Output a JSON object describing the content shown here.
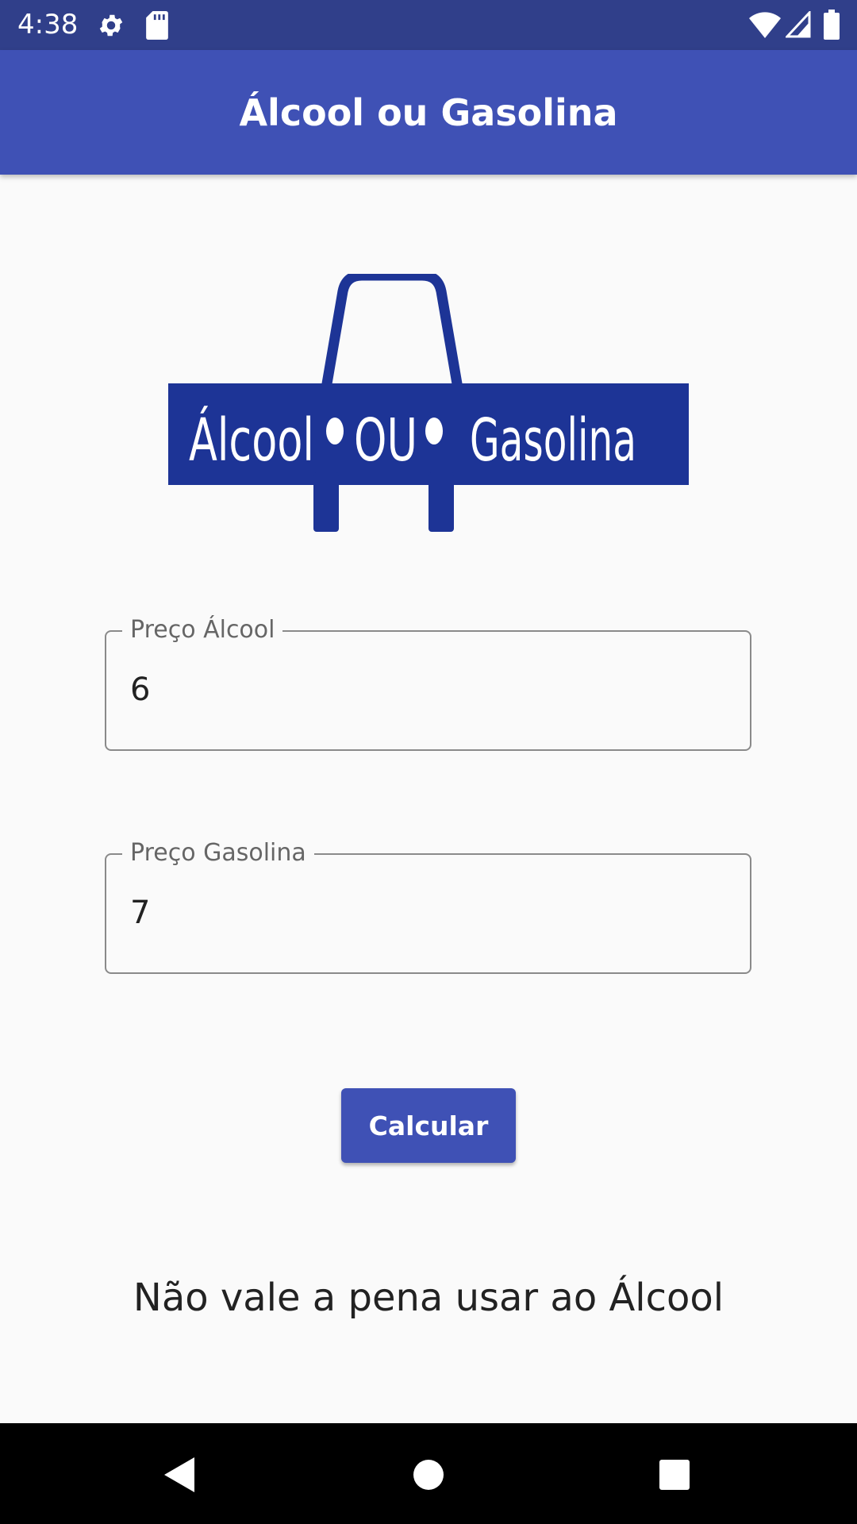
{
  "status_bar": {
    "time": "4:38",
    "icons": [
      "gear-icon",
      "sd-card-icon",
      "wifi-icon",
      "signal-icon",
      "battery-icon"
    ]
  },
  "app_bar": {
    "title": "Álcool ou Gasolina"
  },
  "logo": {
    "text_left": "Álcool",
    "text_middle": "OU",
    "text_right": "Gasolina"
  },
  "form": {
    "alcohol_label": "Preço Álcool",
    "alcohol_value": "6",
    "gasoline_label": "Preço Gasolina",
    "gasoline_value": "7",
    "calculate_label": "Calcular"
  },
  "result": {
    "text": "Não vale a pena usar ao Álcool"
  },
  "nav_bar": {
    "buttons": [
      "back-icon",
      "home-icon",
      "recents-icon"
    ]
  },
  "colors": {
    "primary": "#3f51b5",
    "primary_dark": "#303f8a",
    "logo_blue": "#1d3496",
    "background": "#fafafa"
  }
}
